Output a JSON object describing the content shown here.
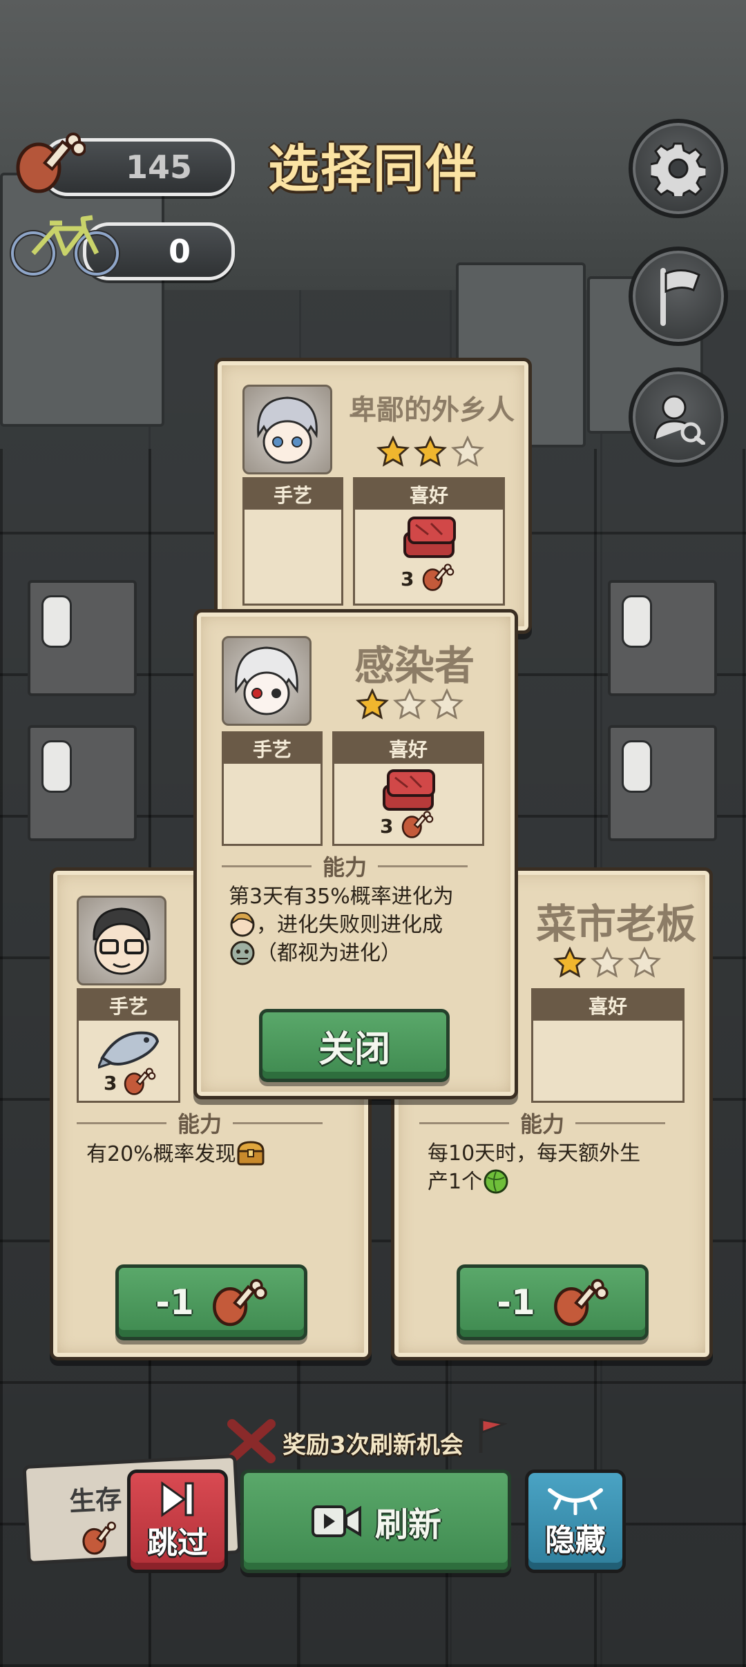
{
  "hud": {
    "meat_count": "145",
    "bike_count": "0",
    "title": "选择同伴"
  },
  "cards": {
    "top": {
      "name": "卑鄙的外乡人",
      "stars_filled": 2,
      "stars_total": 3,
      "craft_label": "手艺",
      "hobby_label": "喜好",
      "hobby_cost": "3"
    },
    "center": {
      "name": "感染者",
      "stars_filled": 1,
      "stars_total": 3,
      "craft_label": "手艺",
      "hobby_label": "喜好",
      "hobby_cost": "3",
      "ability_label": "能力",
      "ability_line1": "第3天有35%概率进化为",
      "ability_line2": "，进化失败则进化成",
      "ability_line3": "（都视为进化）",
      "close_label": "关闭"
    },
    "left": {
      "craft_label": "手艺",
      "craft_cost": "3",
      "ability_label": "能力",
      "ability_text": "有20%概率发现",
      "button_label": "-1"
    },
    "right": {
      "name": "菜市老板",
      "stars_filled": 1,
      "stars_total": 3,
      "hobby_label": "喜好",
      "ability_label": "能力",
      "ability_line1": "每10天时，每天额外生",
      "ability_line2": "产1个",
      "button_label": "-1"
    }
  },
  "bottom": {
    "reward_banner": "奖励3次刷新机会",
    "survive_label": "生存",
    "skip_label": "跳过",
    "refresh_label": "刷新",
    "hide_label": "隐藏"
  },
  "colors": {
    "title": "#fbe3a3",
    "card_bg": "#e7d8b9",
    "green_button": "#4a9a5c",
    "skip_button": "#c9434a",
    "hide_button": "#3d8fb0",
    "star_gold": "#f0b62e"
  }
}
